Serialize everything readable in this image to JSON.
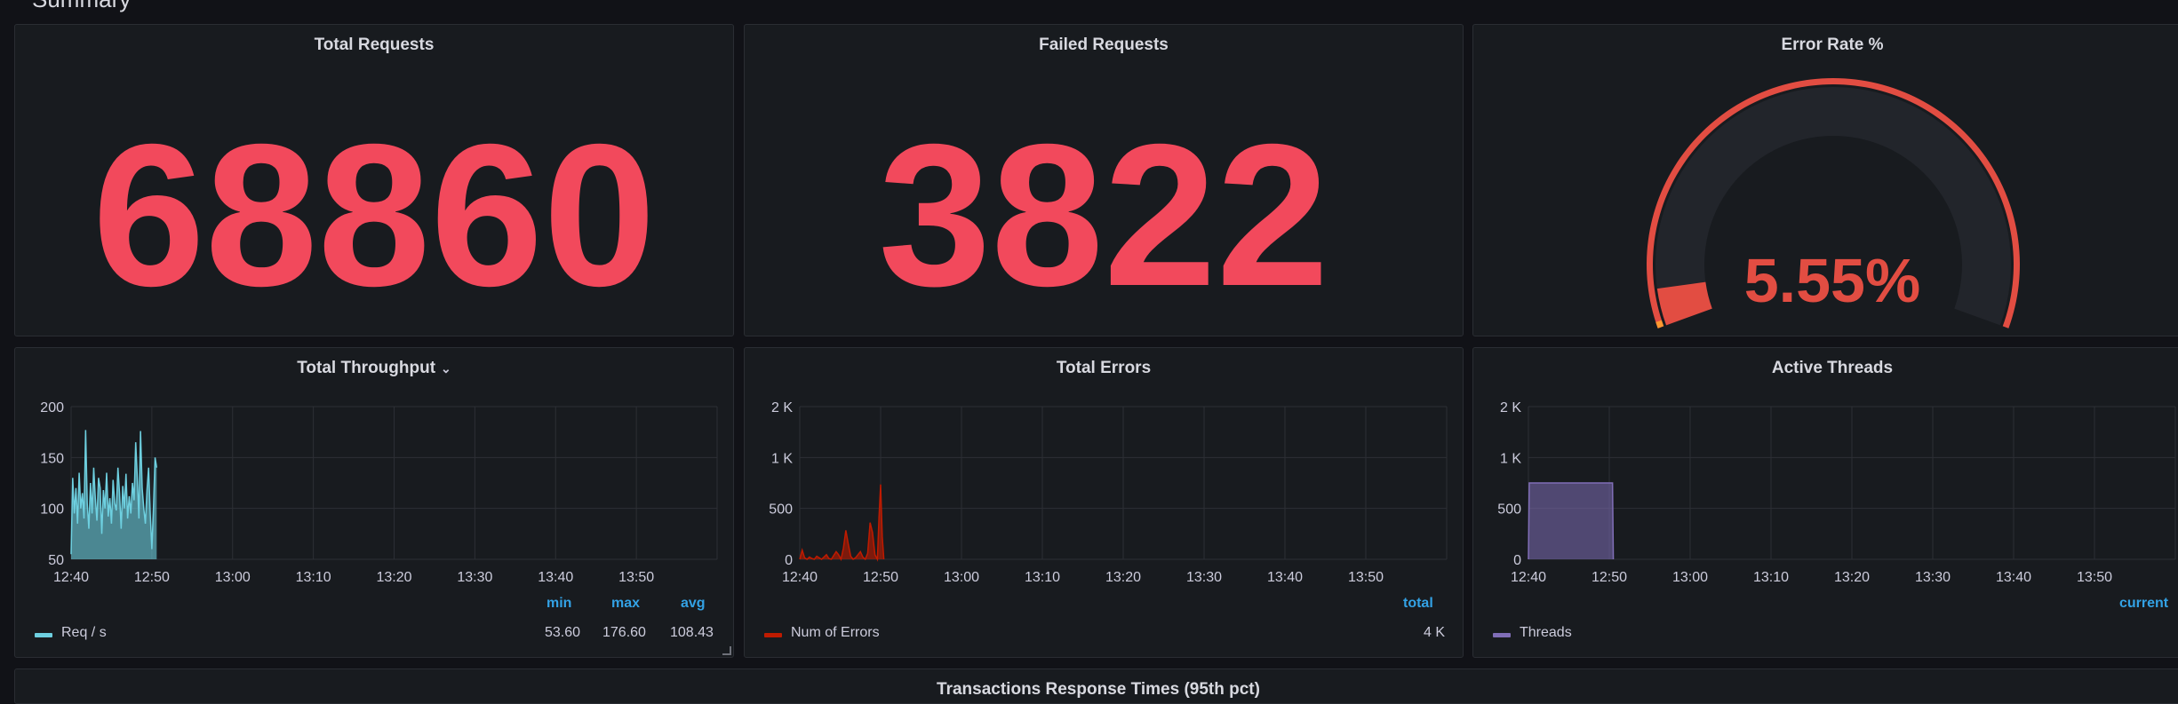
{
  "section": {
    "title": "Summary"
  },
  "stats": {
    "total_requests": {
      "title": "Total Requests",
      "value": "68860",
      "color": "#f2495c"
    },
    "failed_requests": {
      "title": "Failed Requests",
      "value": "3822",
      "color": "#f2495c"
    }
  },
  "gauge": {
    "title": "Error Rate %",
    "value": "5.55%",
    "fraction": 0.0555,
    "color": "#e24d42"
  },
  "throughput": {
    "title": "Total Throughput",
    "legend": {
      "headers": [
        "min",
        "max",
        "avg"
      ],
      "series_label": "Req / s",
      "values": [
        "53.60",
        "176.60",
        "108.43"
      ]
    }
  },
  "errors": {
    "title": "Total Errors",
    "legend": {
      "headers": [
        "total"
      ],
      "series_label": "Num of Errors",
      "values": [
        "4 K"
      ]
    }
  },
  "threads": {
    "title": "Active Threads",
    "legend": {
      "headers": [
        "current"
      ],
      "series_label": "Threads"
    }
  },
  "bottom": {
    "title": "Transactions Response Times (95th pct)"
  },
  "chart_data": [
    {
      "type": "area",
      "title": "Total Throughput",
      "x": [
        "12:40",
        "12:50",
        "13:00",
        "13:10",
        "13:20",
        "13:30",
        "13:40",
        "13:50"
      ],
      "ylim": [
        50,
        200
      ],
      "yticks": [
        "50",
        "100",
        "150",
        "200"
      ],
      "series": [
        {
          "name": "Req / s",
          "color": "#6ed0e0",
          "t": [
            0,
            0.2,
            0.4,
            0.6,
            0.8,
            1,
            1.2,
            1.4,
            1.6,
            1.8,
            2,
            2.2,
            2.4,
            2.6,
            2.8,
            3,
            3.2,
            3.4,
            3.6,
            3.8,
            4,
            4.2,
            4.4,
            4.6,
            4.8,
            5,
            5.2,
            5.4,
            5.6,
            5.8,
            6,
            6.2,
            6.4,
            6.6,
            6.8,
            7,
            7.2,
            7.4,
            7.6,
            7.8,
            8,
            8.2,
            8.4,
            8.6,
            8.8,
            9,
            9.2,
            9.4,
            9.6,
            9.8,
            10,
            10.2,
            10.4,
            10.6
          ],
          "values": [
            55,
            130,
            95,
            120,
            85,
            135,
            100,
            115,
            90,
            177,
            105,
            80,
            125,
            95,
            140,
            110,
            88,
            130,
            120,
            75,
            118,
            100,
            135,
            92,
            110,
            85,
            128,
            105,
            98,
            140,
            115,
            80,
            122,
            100,
            134,
            90,
            112,
            95,
            125,
            108,
            165,
            130,
            90,
            176,
            120,
            100,
            85,
            118,
            140,
            95,
            60,
            100,
            150,
            140
          ]
        }
      ]
    },
    {
      "type": "area",
      "title": "Total Errors",
      "x": [
        "12:40",
        "12:50",
        "13:00",
        "13:10",
        "13:20",
        "13:30",
        "13:40",
        "13:50"
      ],
      "ylim": [
        0,
        2000
      ],
      "yticks": [
        "0",
        "500",
        "1 K",
        "2 K"
      ],
      "series": [
        {
          "name": "Num of Errors",
          "color": "#bf1b00",
          "t": [
            0,
            0.3,
            0.6,
            0.9,
            1.2,
            1.5,
            1.8,
            2.1,
            2.4,
            2.7,
            3,
            3.3,
            3.6,
            3.9,
            4.2,
            4.5,
            4.8,
            5.1,
            5.4,
            5.7,
            6,
            6.3,
            6.6,
            6.9,
            7.2,
            7.5,
            7.8,
            8.1,
            8.4,
            8.7,
            9,
            9.3,
            9.6,
            9.8,
            10,
            10.2,
            10.4
          ],
          "values": [
            0,
            120,
            20,
            0,
            30,
            10,
            0,
            40,
            20,
            0,
            30,
            60,
            10,
            0,
            50,
            100,
            60,
            0,
            150,
            380,
            200,
            40,
            0,
            20,
            60,
            100,
            30,
            0,
            80,
            480,
            350,
            60,
            0,
            550,
            980,
            300,
            0
          ]
        }
      ]
    },
    {
      "type": "area",
      "title": "Active Threads",
      "x": [
        "12:40",
        "12:50",
        "13:00",
        "13:10",
        "13:20",
        "13:30",
        "13:40",
        "13:50"
      ],
      "ylim": [
        0,
        2000
      ],
      "yticks": [
        "0",
        "500",
        "1 K",
        "2 K"
      ],
      "series": [
        {
          "name": "Threads",
          "color": "#806eb7",
          "t": [
            0,
            0.1,
            10.4,
            10.5
          ],
          "values": [
            0,
            1000,
            1000,
            0
          ]
        }
      ]
    }
  ]
}
